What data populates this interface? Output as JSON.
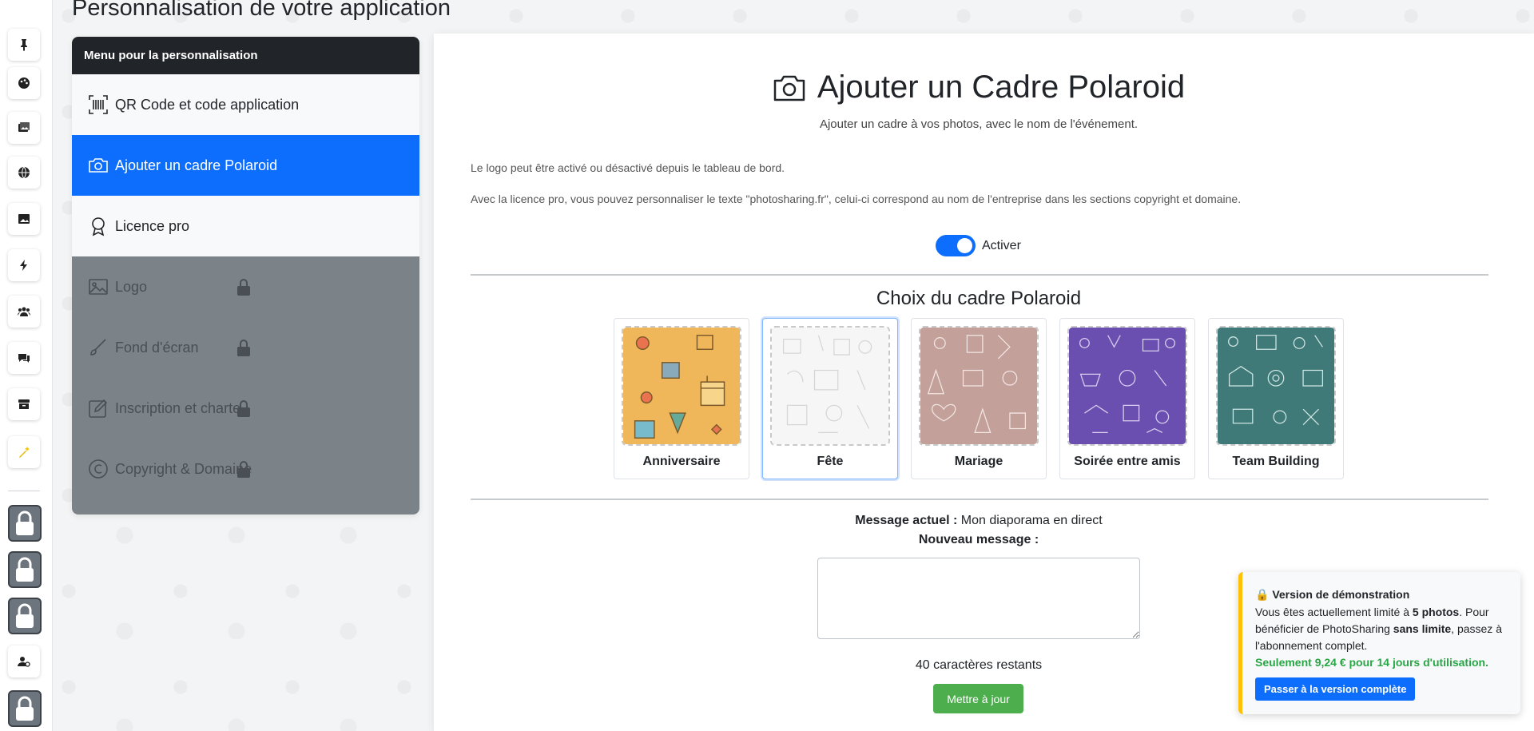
{
  "page": {
    "title": "Personnalisation de votre application"
  },
  "menu": {
    "header": "Menu pour la personnalisation",
    "items": [
      {
        "label": "QR Code et code application",
        "icon": "barcode-icon",
        "state": "normal"
      },
      {
        "label": "Ajouter un cadre Polaroid",
        "icon": "camera-icon",
        "state": "active"
      },
      {
        "label": "Licence pro",
        "icon": "award-icon",
        "state": "normal"
      },
      {
        "label": "Logo",
        "icon": "image-icon",
        "state": "locked"
      },
      {
        "label": "Fond d'écran",
        "icon": "brush-icon",
        "state": "locked"
      },
      {
        "label": "Inscription et charte",
        "icon": "edit-icon",
        "state": "locked"
      },
      {
        "label": "Copyright & Domaine",
        "icon": "copyright-icon",
        "state": "locked"
      }
    ]
  },
  "rail": {
    "icons": [
      "pin-icon",
      "palette-icon",
      "images-icon",
      "globe-icon",
      "image-icon",
      "bolt-icon",
      "users-icon",
      "chat-icon",
      "archive-icon",
      "magic-wand-icon"
    ],
    "locked_count": 4
  },
  "main": {
    "title": "Ajouter un Cadre Polaroid",
    "subtitle": "Ajouter un cadre à vos photos, avec le nom de l'événement.",
    "info1": "Le logo peut être activé ou désactivé depuis le tableau de bord.",
    "info2": "Avec la licence pro, vous pouvez personnaliser le texte \"photosharing.fr\", celui-ci correspond au nom de l'entreprise dans les sections copyright et domaine.",
    "toggle_label": "Activer",
    "toggle_on": true,
    "frames_title": "Choix du cadre Polaroid",
    "frames": [
      {
        "label": "Anniversaire",
        "color": "#f0b65a",
        "selected": false
      },
      {
        "label": "Fête",
        "color": "#f4f4f4",
        "selected": true
      },
      {
        "label": "Mariage",
        "color": "#c4a09a",
        "selected": false
      },
      {
        "label": "Soirée entre amis",
        "color": "#6a4fb0",
        "selected": false
      },
      {
        "label": "Team Building",
        "color": "#3f7a78",
        "selected": false
      }
    ],
    "current_label": "Message actuel :",
    "current_value": "Mon diaporama en direct",
    "new_label": "Nouveau message :",
    "chars_remaining": "40 caractères restants",
    "update_button": "Mettre à jour"
  },
  "toast": {
    "title": "🔒 Version de démonstration",
    "line1_pre": "Vous êtes actuellement limité à ",
    "line1_bold": "5 photos",
    "line1_post": ". Pour bénéficier de PhotoSharing ",
    "line2_bold": "sans limite",
    "line2_post": ", passez à l'abonnement complet.",
    "offer": "Seulement 9,24 € pour 14 jours d'utilisation.",
    "button": "Passer à la version complète"
  },
  "colors": {
    "accent": "#0d6efd",
    "success": "#4cae4c",
    "warning": "#ffc107",
    "dark": "#212529"
  }
}
